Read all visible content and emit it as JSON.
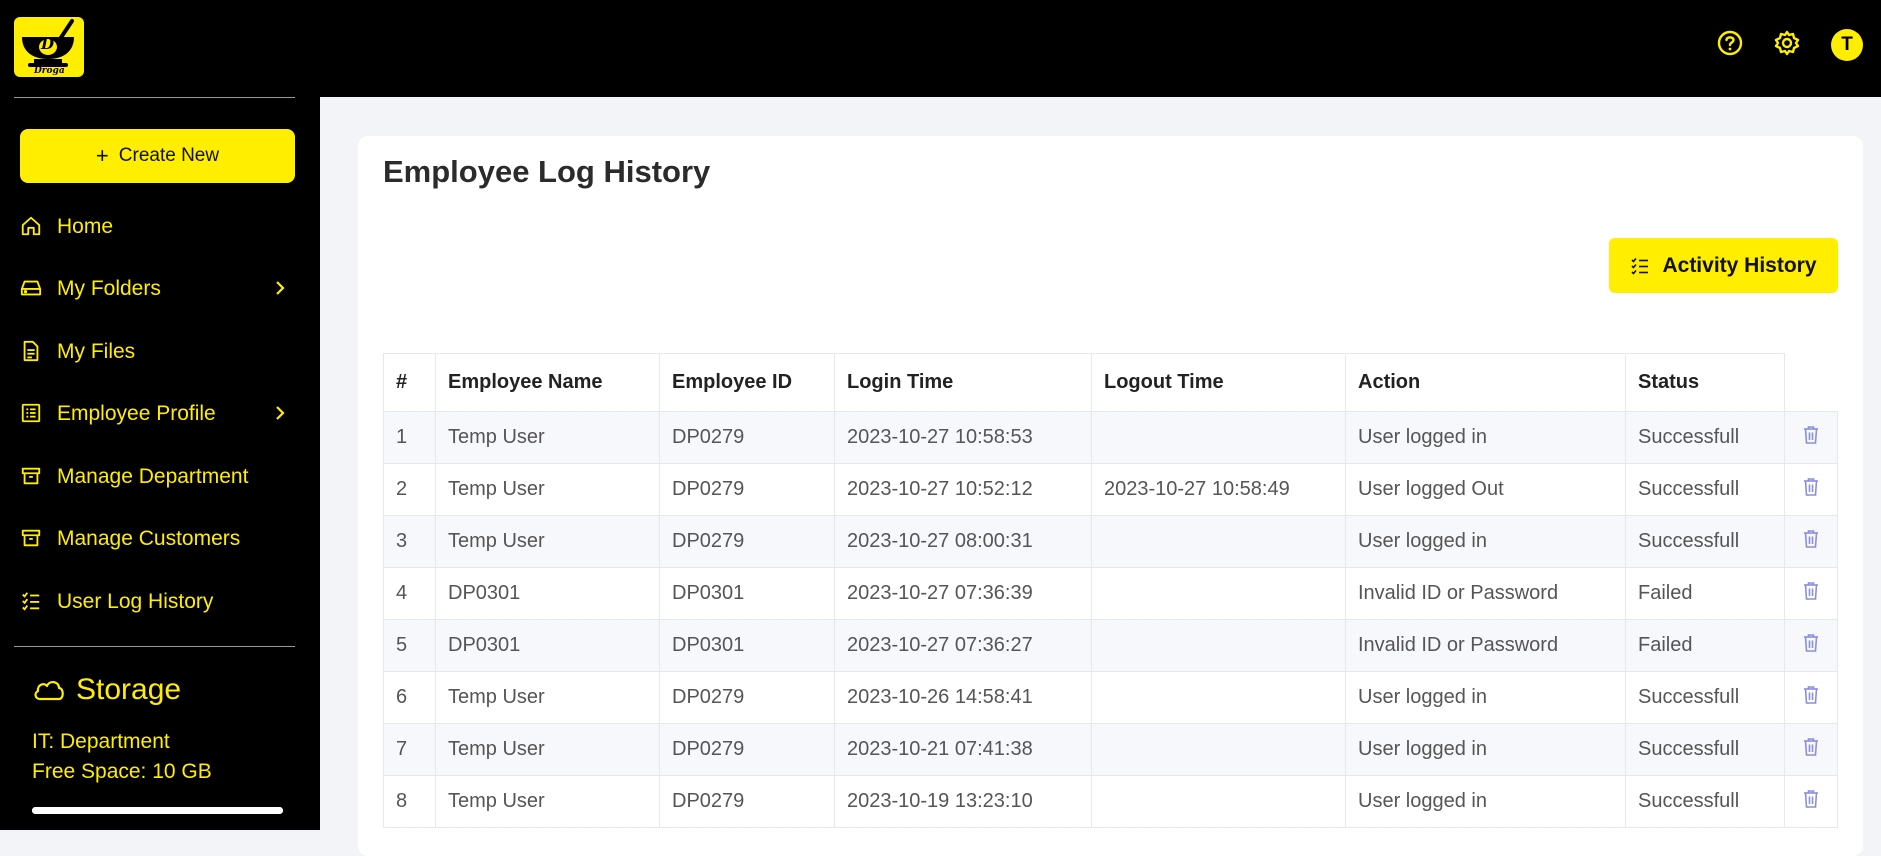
{
  "brand": {
    "logo_letter": "D",
    "logo_text": "Droga"
  },
  "sidebar": {
    "create_label": "Create New",
    "items": [
      {
        "label": "Home",
        "icon": "home-icon"
      },
      {
        "label": "My Folders",
        "icon": "drive-icon"
      },
      {
        "label": "My Files",
        "icon": "file-icon"
      },
      {
        "label": "Employee Profile",
        "icon": "profile-list-icon"
      },
      {
        "label": "Manage Department",
        "icon": "archive-icon"
      },
      {
        "label": "Manage Customers",
        "icon": "archive-icon"
      },
      {
        "label": "User Log History",
        "icon": "list-check-icon"
      }
    ],
    "storage": {
      "title": "Storage",
      "department": "IT: Department",
      "free_space": "Free Space: 10 GB",
      "usage_fraction": 1.0
    }
  },
  "header": {
    "help_icon": "help-icon",
    "settings_icon": "gear-icon",
    "avatar_letter": "T"
  },
  "main": {
    "title": "Employee Log History",
    "activity_button": "Activity History",
    "table": {
      "headers": [
        "#",
        "Employee Name",
        "Employee ID",
        "Login Time",
        "Logout Time",
        "Action",
        "Status"
      ],
      "rows": [
        [
          "1",
          "Temp User",
          "DP0279",
          "2023-10-27 10:58:53",
          "",
          "User logged in",
          "Successfull"
        ],
        [
          "2",
          "Temp User",
          "DP0279",
          "2023-10-27 10:52:12",
          "2023-10-27 10:58:49",
          "User logged Out",
          "Successfull"
        ],
        [
          "3",
          "Temp User",
          "DP0279",
          "2023-10-27 08:00:31",
          "",
          "User logged in",
          "Successfull"
        ],
        [
          "4",
          "DP0301",
          "DP0301",
          "2023-10-27 07:36:39",
          "",
          "Invalid ID or Password",
          "Failed"
        ],
        [
          "5",
          "DP0301",
          "DP0301",
          "2023-10-27 07:36:27",
          "",
          "Invalid ID or Password",
          "Failed"
        ],
        [
          "6",
          "Temp User",
          "DP0279",
          "2023-10-26 14:58:41",
          "",
          "User logged in",
          "Successfull"
        ],
        [
          "7",
          "Temp User",
          "DP0279",
          "2023-10-21 07:41:38",
          "",
          "User logged in",
          "Successfull"
        ],
        [
          "8",
          "Temp User",
          "DP0279",
          "2023-10-19 13:23:10",
          "",
          "User logged in",
          "Successfull"
        ]
      ]
    }
  },
  "colors": {
    "accent": "#ffee00",
    "sidebar_bg": "#000000",
    "page_bg": "#f3f4f8",
    "trash": "#8b8fd6"
  }
}
